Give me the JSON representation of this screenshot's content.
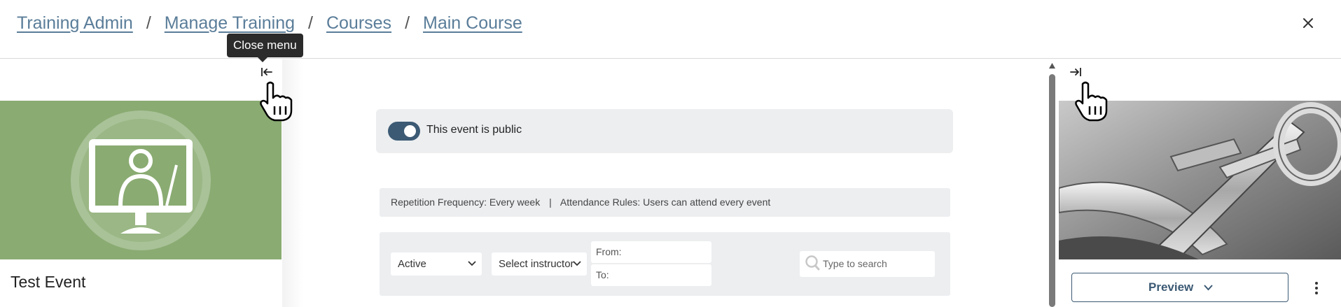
{
  "breadcrumb": {
    "items": [
      "Training Admin",
      "Manage Training",
      "Courses",
      "Main Course"
    ],
    "separator": "/"
  },
  "icons": {
    "close": "close-icon",
    "collapse_left": "collapse-left-icon",
    "collapse_right": "collapse-right-icon",
    "search": "search-icon",
    "kebab": "more-vertical-icon",
    "cursor": "hand-pointer-icon"
  },
  "tooltip": {
    "text": "Close menu"
  },
  "left_panel": {
    "event_title": "Test Event",
    "image": "virtual-classroom-placeholder"
  },
  "middle": {
    "public_toggle": {
      "label": "This event is public",
      "checked": true
    },
    "rules": {
      "repetition": "Repetition Frequency: Every week",
      "divider": "|",
      "attendance": "Attendance Rules: Users can attend every event"
    },
    "filters": {
      "status_select": "Active",
      "instructor_select": "Select instructor",
      "from_label": "From:",
      "to_label": "To:",
      "search_placeholder": "Type to search"
    }
  },
  "right_panel": {
    "image": "metal-tools-photo",
    "preview_button": "Preview"
  },
  "colors": {
    "accent": "#3c5a74",
    "link": "#5a7d99",
    "panel_bg": "#eceef0",
    "image_green": "#8aab72"
  }
}
